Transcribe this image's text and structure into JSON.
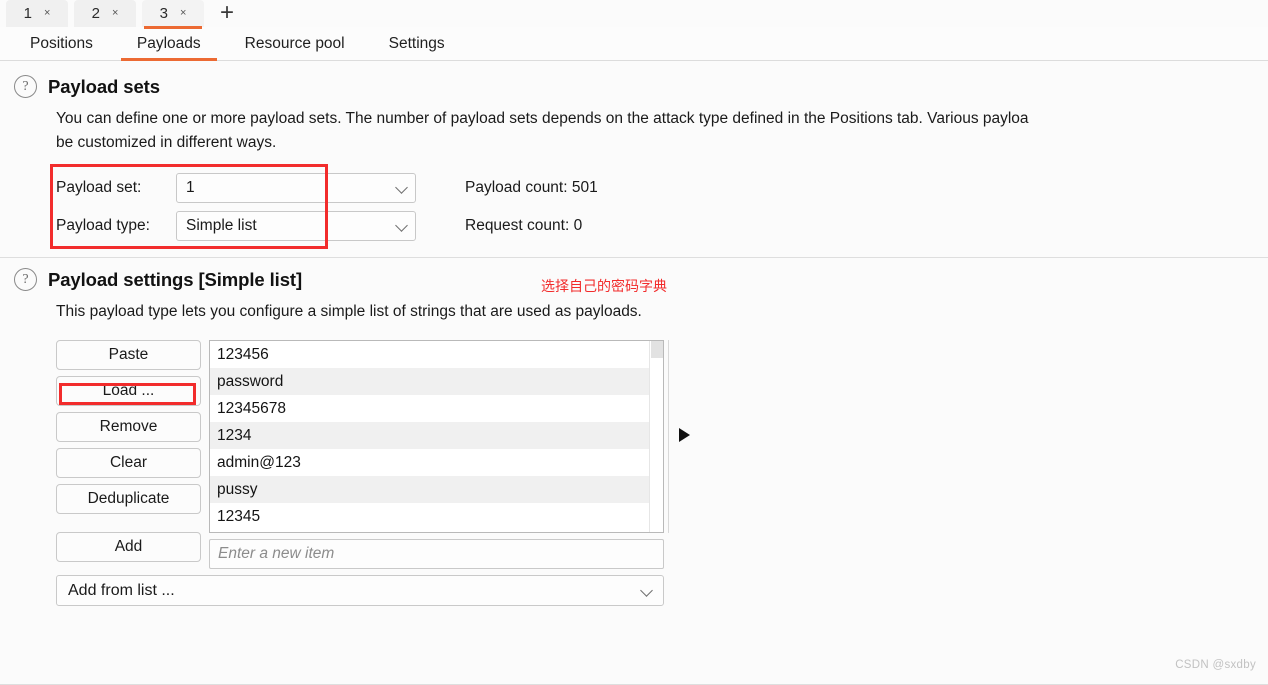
{
  "theme": {
    "accent": "#ec6a33",
    "annotation": "#f22c2c"
  },
  "attack_tabs": {
    "items": [
      {
        "label": "1",
        "close": "×",
        "active": false
      },
      {
        "label": "2",
        "close": "×",
        "active": false
      },
      {
        "label": "3",
        "close": "×",
        "active": true
      }
    ],
    "new_tab": "+"
  },
  "section_tabs": [
    {
      "label": "Positions",
      "active": false
    },
    {
      "label": "Payloads",
      "active": true
    },
    {
      "label": "Resource pool",
      "active": false
    },
    {
      "label": "Settings",
      "active": false
    }
  ],
  "payload_sets": {
    "help_icon": "?",
    "title": "Payload sets",
    "description_line1": "You can define one or more payload sets. The number of payload sets depends on the attack type defined in the Positions tab. Various payloa",
    "description_line2": "be customized in different ways.",
    "payload_set_label": "Payload set:",
    "payload_set_value": "1",
    "payload_type_label": "Payload type:",
    "payload_type_value": "Simple list",
    "payload_count": "Payload count: 501",
    "request_count": "Request count: 0"
  },
  "annotation": {
    "chinese_note": "选择自己的密码字典"
  },
  "payload_settings": {
    "help_icon": "?",
    "title": "Payload settings [Simple list]",
    "description": "This payload type lets you configure a simple list of strings that are used as payloads.",
    "buttons": [
      {
        "label": "Paste",
        "highlighted": false
      },
      {
        "label": "Load ...",
        "highlighted": true
      },
      {
        "label": "Remove",
        "highlighted": false
      },
      {
        "label": "Clear",
        "highlighted": false
      },
      {
        "label": "Deduplicate",
        "highlighted": false
      },
      {
        "label": "Add",
        "highlighted": false
      }
    ],
    "add_from_list": "Add from list ...",
    "new_item_placeholder": "Enter a new item",
    "new_item_value": "",
    "list_items": [
      "123456",
      "password",
      "12345678",
      "1234",
      "admin@123",
      "pussy",
      "12345"
    ]
  },
  "watermark": "CSDN @sxdby"
}
